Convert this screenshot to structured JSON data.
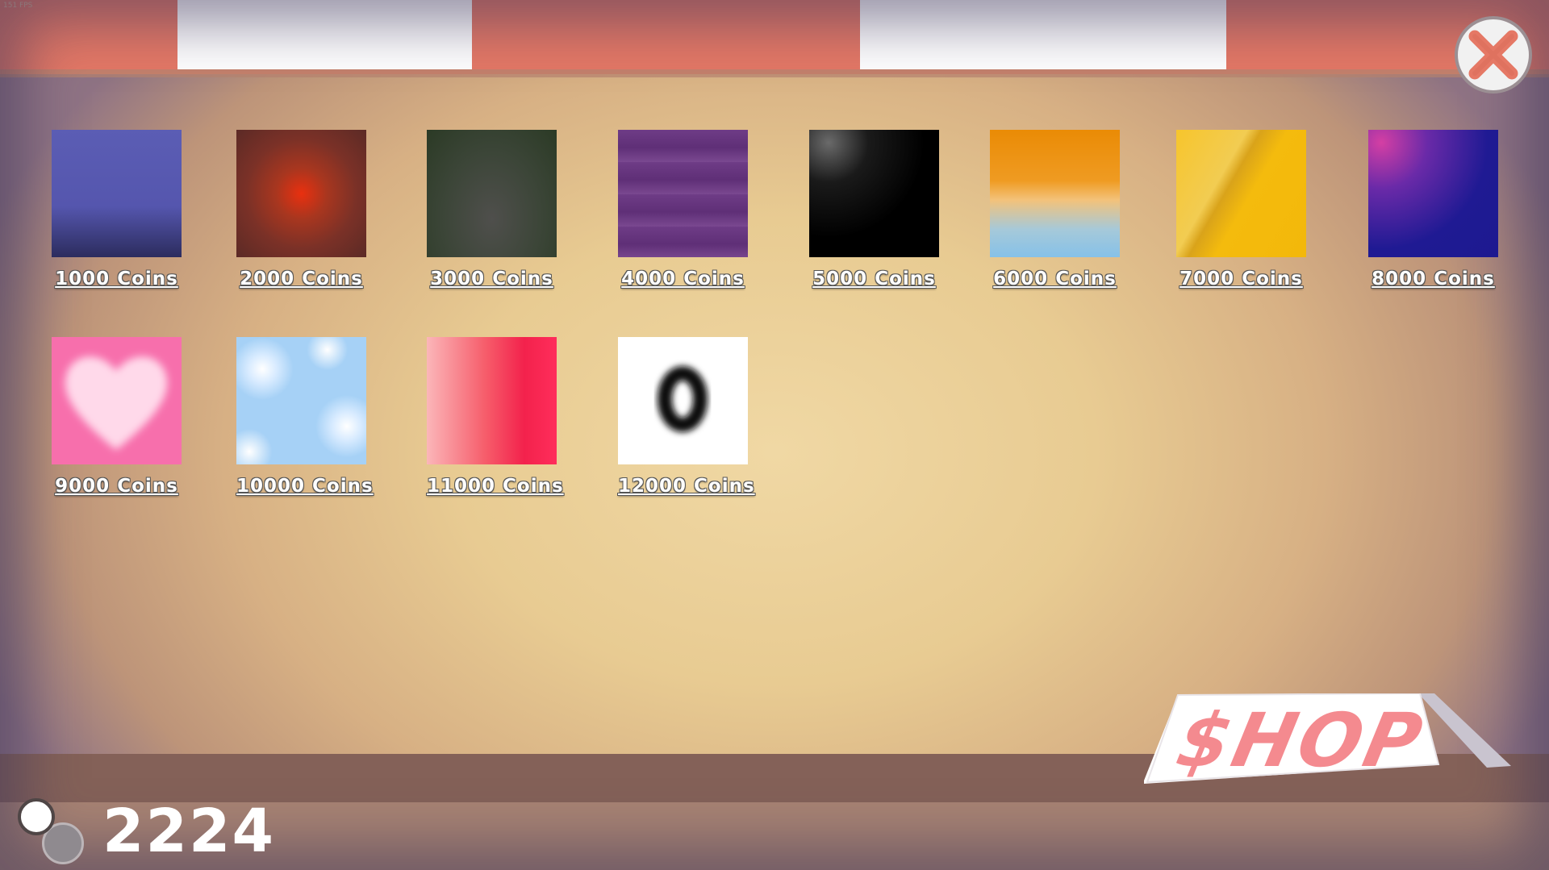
{
  "hud": {
    "fps_text": "151 FPS",
    "coins": "2224"
  },
  "shop_sign": {
    "label": "$HOP"
  },
  "close": {
    "icon": "close-x-icon",
    "color": "#e57865"
  },
  "colors": {
    "awning_red": "#e57865",
    "awning_white": "#ffffff",
    "counter": "#846158",
    "floor": "#a88373"
  },
  "items": [
    {
      "name": "blue",
      "price": "1000 Coins"
    },
    {
      "name": "red-glow",
      "price": "2000 Coins"
    },
    {
      "name": "dark-green",
      "price": "3000 Coins"
    },
    {
      "name": "purple-stripes",
      "price": "4000 Coins"
    },
    {
      "name": "black-gloss",
      "price": "5000 Coins"
    },
    {
      "name": "sunset",
      "price": "6000 Coins"
    },
    {
      "name": "gold",
      "price": "7000 Coins"
    },
    {
      "name": "galaxy",
      "price": "8000 Coins"
    },
    {
      "name": "pink-heart",
      "price": "9000 Coins"
    },
    {
      "name": "sky-bubbles",
      "price": "10000 Coins"
    },
    {
      "name": "pink-red-gradient",
      "price": "11000 Coins"
    },
    {
      "name": "white-ring",
      "price": "12000 Coins"
    }
  ]
}
